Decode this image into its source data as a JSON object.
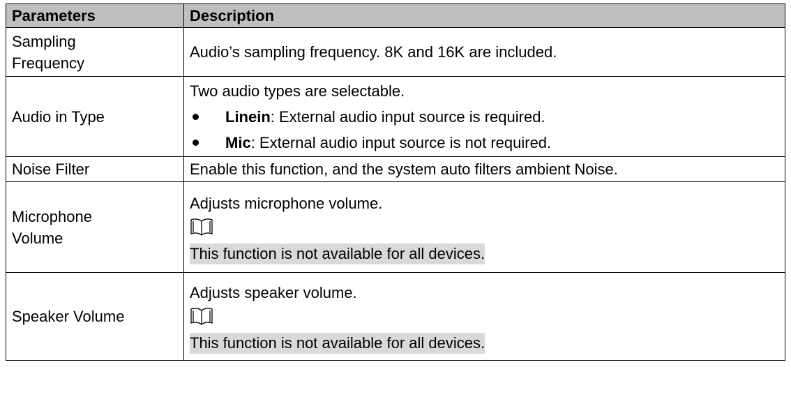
{
  "table": {
    "headers": [
      "Parameters",
      "Description"
    ],
    "rows": [
      {
        "param": "Sampling Frequency",
        "desc": "Audio’s sampling frequency. 8K and 16K are included."
      },
      {
        "param": "Audio in Type",
        "intro": "Two audio types are selectable.",
        "bullets": [
          {
            "term": "Linein",
            "text": ": External audio input source is required."
          },
          {
            "term": "Mic",
            "text": ": External audio input source is not required."
          }
        ]
      },
      {
        "param": "Noise Filter",
        "desc": "Enable this function, and the system auto filters ambient Noise."
      },
      {
        "param": "Microphone Volume",
        "desc": "Adjusts microphone volume.",
        "icon": "book-icon",
        "note": "This function is not available for all devices."
      },
      {
        "param": "Speaker Volume",
        "desc": "Adjusts speaker volume.",
        "icon": "book-icon",
        "note": "This function is not available for all devices."
      }
    ]
  }
}
